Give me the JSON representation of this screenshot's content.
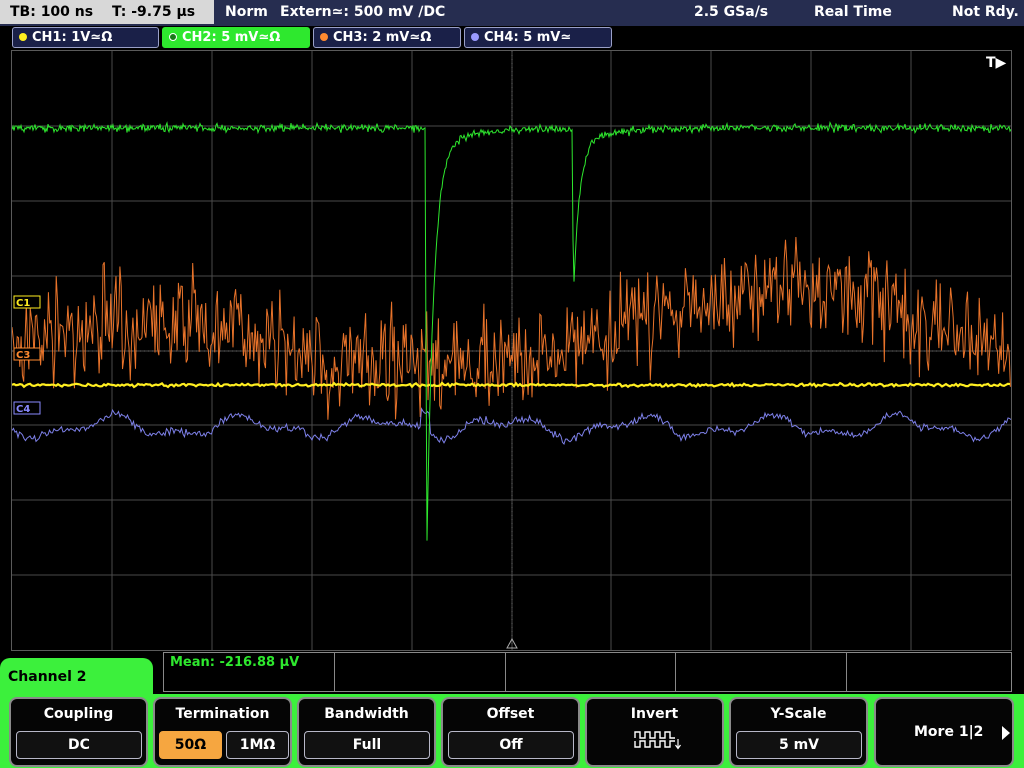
{
  "status": {
    "timebase": "TB: 100 ns",
    "trigger_time": "T: -9.75 µs",
    "mode": "Norm",
    "trigger": "Extern≃: 500 mV ∕DC",
    "sample_rate": "2.5 GSa/s",
    "acquisition": "Real Time",
    "state": "Not Rdy."
  },
  "channels": [
    {
      "label": "CH1: 1V≃Ω",
      "color": "#ffee20",
      "active": false
    },
    {
      "label": "CH2: 5 mV≃Ω",
      "color": "#2ee82e",
      "active": true
    },
    {
      "label": "CH3: 2 mV≃Ω",
      "color": "#ff8a30",
      "active": false
    },
    {
      "label": "CH4: 5 mV≃",
      "color": "#8a8aff",
      "active": false
    }
  ],
  "markers": {
    "trigger": "T▶",
    "c1": "C1",
    "c3": "C3",
    "c4": "C4"
  },
  "trace_colors": {
    "ch1": "#ffee20",
    "ch2": "#2ee82e",
    "ch3": "#e8732a",
    "ch4": "#7d80e8",
    "grid": "#4a4a4a"
  },
  "measurement": {
    "label": "Mean: -216.88 µV"
  },
  "menu": {
    "title": "Channel 2",
    "coupling": {
      "label": "Coupling",
      "value": "DC"
    },
    "termination": {
      "label": "Termination",
      "options": [
        "50Ω",
        "1MΩ"
      ],
      "selected": "50Ω"
    },
    "bandwidth": {
      "label": "Bandwidth",
      "value": "Full"
    },
    "offset": {
      "label": "Offset",
      "value": "Off"
    },
    "invert": {
      "label": "Invert",
      "icon": "invert-pulse-icon"
    },
    "yscale": {
      "label": "Y-Scale",
      "value": "5 mV"
    },
    "more": {
      "label": "More 1|2",
      "icon": "arrow-right-icon"
    }
  }
}
